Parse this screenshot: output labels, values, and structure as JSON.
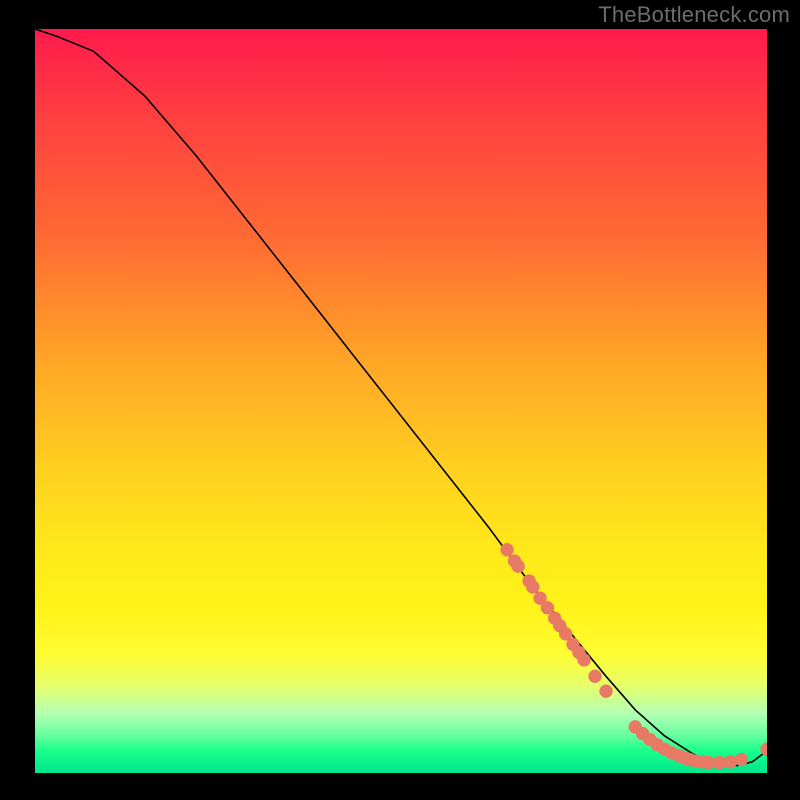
{
  "watermark": "TheBottleneck.com",
  "colors": {
    "marker": "#e77965",
    "curve": "#000000"
  },
  "chart_data": {
    "type": "line",
    "title": "",
    "xlabel": "",
    "ylabel": "",
    "xlim": [
      0,
      100
    ],
    "ylim": [
      0,
      100
    ],
    "series": [
      {
        "name": "curve",
        "x": [
          0,
          3,
          8,
          15,
          22,
          30,
          38,
          46,
          54,
          62,
          68,
          73,
          78,
          82,
          86,
          90,
          93,
          96,
          98,
          100
        ],
        "y": [
          100,
          99,
          97,
          91,
          83,
          73,
          63,
          53,
          43,
          33,
          25,
          19,
          13,
          8.5,
          5,
          2.5,
          1.3,
          1,
          1.5,
          3
        ]
      }
    ],
    "markers": [
      {
        "x": 64.5,
        "y": 30.0
      },
      {
        "x": 65.5,
        "y": 28.5
      },
      {
        "x": 66.0,
        "y": 27.8
      },
      {
        "x": 67.5,
        "y": 25.8
      },
      {
        "x": 68.0,
        "y": 25.0
      },
      {
        "x": 69.0,
        "y": 23.5
      },
      {
        "x": 70.0,
        "y": 22.2
      },
      {
        "x": 71.0,
        "y": 20.8
      },
      {
        "x": 71.7,
        "y": 19.8
      },
      {
        "x": 72.5,
        "y": 18.7
      },
      {
        "x": 73.5,
        "y": 17.3
      },
      {
        "x": 74.3,
        "y": 16.2
      },
      {
        "x": 75.0,
        "y": 15.2
      },
      {
        "x": 76.5,
        "y": 13.0
      },
      {
        "x": 78.0,
        "y": 11.0
      },
      {
        "x": 82.0,
        "y": 6.2
      },
      {
        "x": 83.0,
        "y": 5.3
      },
      {
        "x": 84.0,
        "y": 4.5
      },
      {
        "x": 85.0,
        "y": 3.8
      },
      {
        "x": 86.0,
        "y": 3.2
      },
      {
        "x": 87.0,
        "y": 2.7
      },
      {
        "x": 88.0,
        "y": 2.3
      },
      {
        "x": 88.8,
        "y": 2.0
      },
      {
        "x": 89.5,
        "y": 1.8
      },
      {
        "x": 90.3,
        "y": 1.6
      },
      {
        "x": 91.2,
        "y": 1.5
      },
      {
        "x": 92.0,
        "y": 1.4
      },
      {
        "x": 93.5,
        "y": 1.4
      },
      {
        "x": 95.0,
        "y": 1.5
      },
      {
        "x": 96.5,
        "y": 1.8
      },
      {
        "x": 100.0,
        "y": 3.2
      }
    ]
  }
}
